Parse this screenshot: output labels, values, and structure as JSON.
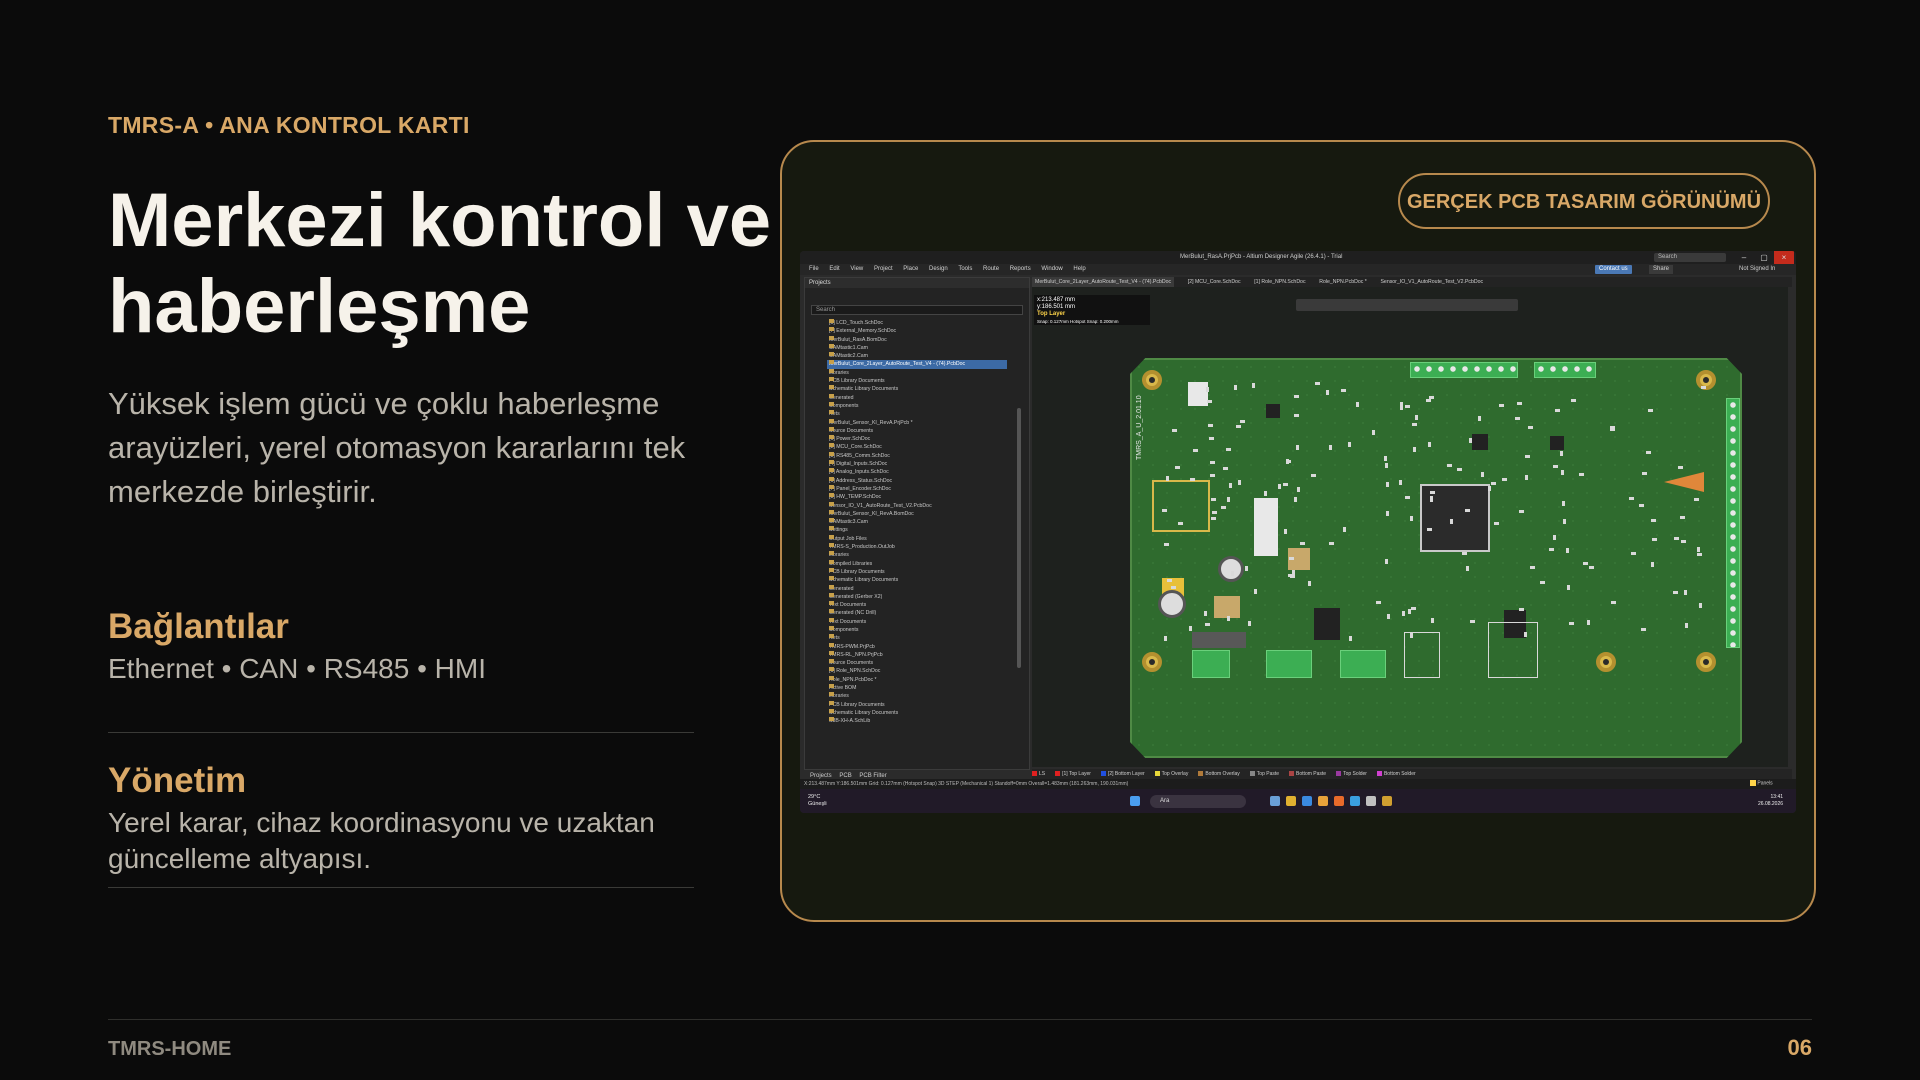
{
  "slide": {
    "eyebrow": "TMRS-A • ANA KONTROL KARTI",
    "title": "Merkezi kontrol ve haberleşme",
    "subtitle": "Yüksek işlem gücü ve çoklu haberleşme arayüzleri, yerel otomasyon kararlarını tek merkezde birleştirir.",
    "features": [
      {
        "heading": "Bağlantılar",
        "text": "Ethernet • CAN • RS485 • HMI"
      },
      {
        "heading": "Yönetim",
        "text": "Yerel karar, cihaz koordinasyonu ve uzaktan güncelleme altyapısı."
      }
    ],
    "badge": "GERÇEK PCB TASARIM GÖRÜNÜMÜ",
    "footer_left": "TMRS-HOME",
    "page_number": "06"
  },
  "screenshot": {
    "window_title": "MerBulut_RasA.PrjPcb - Altium Designer Agile (26.4.1) - Trial",
    "search": "Search",
    "menu": [
      "File",
      "Edit",
      "View",
      "Project",
      "Place",
      "Design",
      "Tools",
      "Route",
      "Reports",
      "Window",
      "Help"
    ],
    "contact": "Contact us",
    "share": "Share",
    "not_signed_in": "Not Signed In",
    "projects_panel_title": "Projects",
    "projects_search": "Search",
    "tree": [
      "[5] LCD_Touch.SchDoc",
      "[7] External_Memory.SchDoc",
      "MerBulut_RasA.BomDoc",
      "CAMtastic1.Cam",
      "CAMtastic2.Cam",
      "MerBulut_Core_2Layer_AutoRoute_Test_V4 - (74).PcbDoc",
      "Libraries",
      "PCB Library Documents",
      "Schematic Library Documents",
      "Generated",
      "Components",
      "Nets",
      "MerBulut_Sensor_KI_RevA.PrjPcb *",
      "Source Documents",
      "[1] Power.SchDoc",
      "[2] MCU_Core.SchDoc",
      "[3] RS485_Comm.SchDoc",
      "[4] Digital_Inputs.SchDoc",
      "[5] Analog_Inputs.SchDoc",
      "[6] Address_Status.SchDoc",
      "[7] Panel_Encoder.SchDoc",
      "[8] HW_TEMP.SchDoc",
      "Sensor_IO_V1_AutoRoute_Test_V2.PcbDoc",
      "MerBulut_Sensor_KI_RevA.BomDoc",
      "CAMtastic3.Cam",
      "Settings",
      "Output Job Files",
      "TMRS-S_Production.OutJob",
      "Libraries",
      "Compiled Libraries",
      "PCB Library Documents",
      "Schematic Library Documents",
      "Generated",
      "Generated (Gerber X2)",
      "Text Documents",
      "Generated (NC Drill)",
      "Text Documents",
      "Components",
      "Nets",
      "TMRS-PWM.PrjPcb",
      "TMRS-RL_NPN.PrjPcb",
      "Source Documents",
      "[1] Role_NPN.SchDoc",
      "Role_NPN.PcbDoc *",
      "Active BOM",
      "Libraries",
      "PCB Library Documents",
      "Schematic Library Documents",
      "S3B-XH-A.SchLib"
    ],
    "selected_tree_index": 5,
    "panel_tabs": [
      "Projects",
      "PCB",
      "PCB Filter"
    ],
    "doc_tabs": [
      "MerBulut_Core_2Layer_AutoRoute_Test_V4 - (74).PcbDoc",
      "[2] MCU_Core.SchDoc",
      "[1] Role_NPN.SchDoc",
      "Role_NPN.PcbDoc *",
      "Sensor_IO_V1_AutoRoute_Test_V2.PcbDoc"
    ],
    "hud": {
      "x": "x:213.487 mm",
      "y": "y:186.501 mm",
      "layer": "Top Layer",
      "snap": "Snap: 0.127mm Hotspot Snap: 0.200mm"
    },
    "silkscreen": "TMRS_A_U_2.01.10",
    "layers": [
      {
        "name": "LS",
        "color": "#e02020"
      },
      {
        "name": "[1] Top Layer",
        "color": "#e02020"
      },
      {
        "name": "[2] Bottom Layer",
        "color": "#2050e0"
      },
      {
        "name": "Top Overlay",
        "color": "#e8d83a"
      },
      {
        "name": "Bottom Overlay",
        "color": "#b07a3a"
      },
      {
        "name": "Top Paste",
        "color": "#888888"
      },
      {
        "name": "Bottom Paste",
        "color": "#aa4444"
      },
      {
        "name": "Top Solder",
        "color": "#9a3aa0"
      },
      {
        "name": "Bottom Solder",
        "color": "#d040d0"
      }
    ],
    "status": "X:213.487mm Y:186.501mm   Grid: 0.127mm   (Hotspot Snap)        3D STEP (Mechanical 1)  Standoff=0mm  Overall=1.483mm  (181.263mm, 190.031mm)",
    "panels_label": "Panels",
    "taskbar": {
      "temp": "29°C",
      "weather": "Güneşli",
      "search": "Ara",
      "time": "13:41",
      "date": "26.08.2026"
    }
  }
}
